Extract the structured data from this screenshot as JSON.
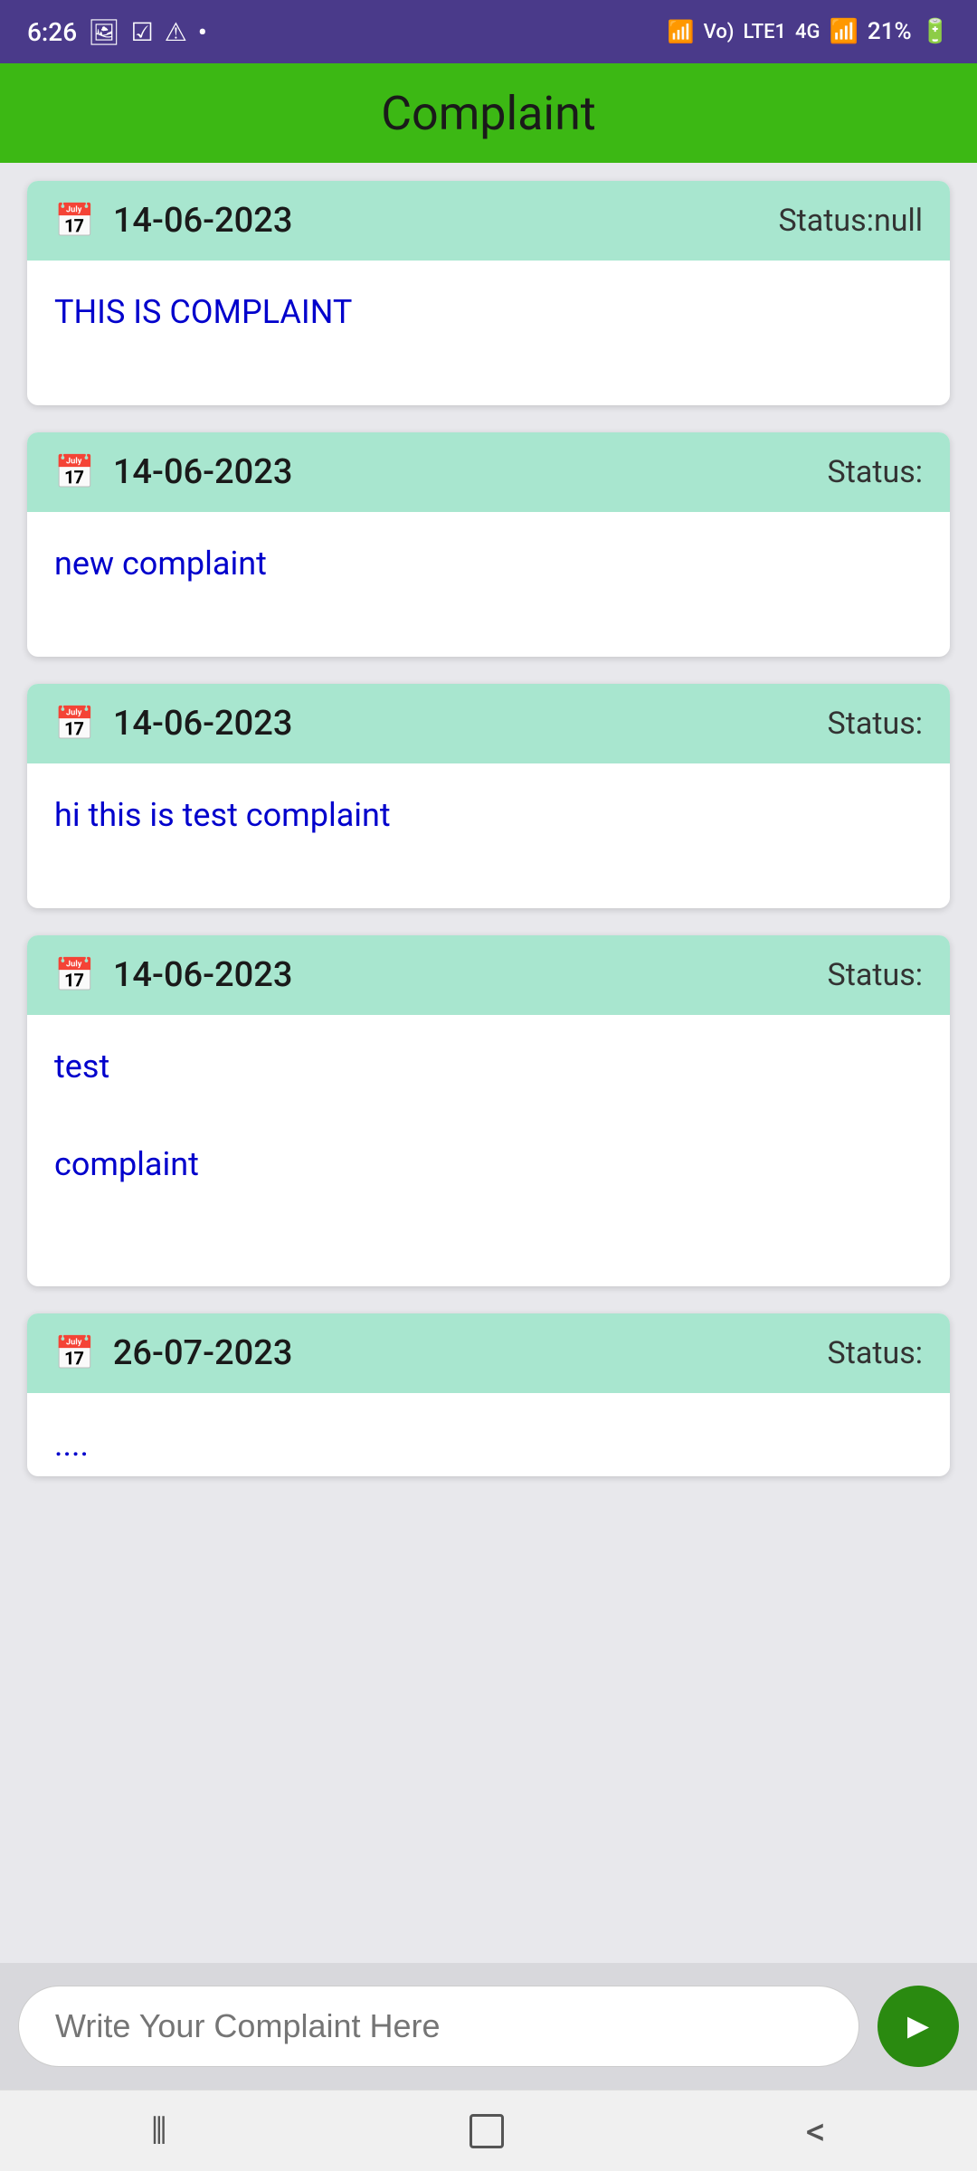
{
  "statusBar": {
    "time": "6:26",
    "battery": "21%",
    "icons": [
      "photo-icon",
      "checkbox-icon",
      "warning-icon",
      "dot-icon",
      "wifi-calling-icon",
      "volte-icon",
      "4g-icon",
      "signal-icon",
      "battery-icon"
    ]
  },
  "appBar": {
    "title": "Complaint"
  },
  "complaints": [
    {
      "id": 1,
      "date": "14-06-2023",
      "status": "Status:null",
      "text": "THIS IS COMPLAINT"
    },
    {
      "id": 2,
      "date": "14-06-2023",
      "status": "Status:",
      "text": "new complaint"
    },
    {
      "id": 3,
      "date": "14-06-2023",
      "status": "Status:",
      "text": "hi this is test complaint"
    },
    {
      "id": 4,
      "date": "14-06-2023",
      "status": "Status:",
      "text": "test\n\ncomplaint"
    },
    {
      "id": 5,
      "date": "26-07-2023",
      "status": "Status:",
      "text": "...."
    }
  ],
  "inputField": {
    "placeholder": "Write Your Complaint Here"
  },
  "sendButton": {
    "label": "Send"
  },
  "navBar": {
    "items": [
      "menu-icon",
      "home-icon",
      "back-icon"
    ]
  }
}
